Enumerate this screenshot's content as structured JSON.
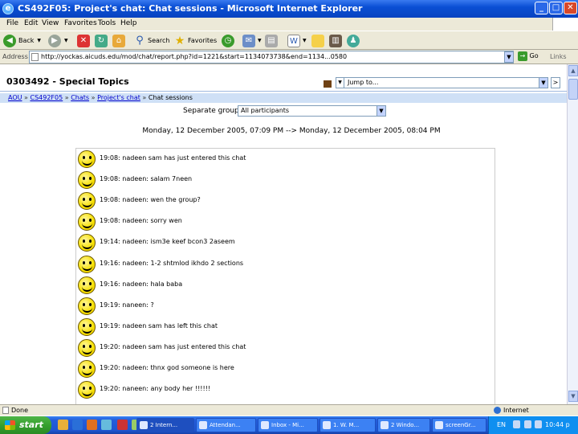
{
  "window": {
    "title": "CS492F05: Project's chat: Chat sessions - Microsoft Internet Explorer",
    "minimize": "_",
    "maximize": "□",
    "close": "✕"
  },
  "menu": [
    "File",
    "Edit",
    "View",
    "Favorites",
    "Tools",
    "Help"
  ],
  "toolbar": {
    "back": "Back",
    "search": "Search",
    "favorites": "Favorites"
  },
  "address": {
    "label": "Address",
    "url": "http://yockas.aicuds.edu/mod/chat/report.php?id=1221&start=1134073738&end=1134...0580",
    "go": "Go",
    "links": "Links"
  },
  "page": {
    "course_title": "0303492 - Special Topics",
    "jump_placeholder": "Jump to...",
    "jump_go": ">",
    "breadcrumb": {
      "site": "AOU",
      "course": "CS492F05",
      "chats": "Chats",
      "chat": "Project's chat",
      "current": "Chat sessions",
      "sep": "»"
    },
    "group_label": "Separate groups",
    "group_value": "All participants",
    "session_range": "Monday, 12 December 2005, 07:09 PM --> Monday, 12 December 2005, 08:04 PM"
  },
  "messages": [
    {
      "text": "19:08: nadeen sam has just entered this chat"
    },
    {
      "text": "19:08: nadeen: salam 7neen"
    },
    {
      "text": "19:08: nadeen: wen the group?"
    },
    {
      "text": "19:08: nadeen: sorry wen"
    },
    {
      "text": "19:14: nadeen: ism3e keef bcon3 2aseem"
    },
    {
      "text": "19:16: nadeen: 1-2 shtmlod ikhdo 2 sections"
    },
    {
      "text": "19:16: nadeen: hala baba"
    },
    {
      "text": "19:19: naneen: ?"
    },
    {
      "text": "19:19: nadeen sam has left this chat"
    },
    {
      "text": "19:20: nadeen sam has just entered this chat"
    },
    {
      "text": "19:20: nadeen: thnx god someone is here"
    },
    {
      "text": "19:20: naneen: any body her !!!!!!"
    }
  ],
  "status": {
    "left": "Done",
    "zone": "Internet"
  },
  "taskbar": {
    "start": "start",
    "tasks": [
      "2 Intern...",
      "Attendan...",
      "Inbox - Mi...",
      "1. W. M...",
      "2 Windo...",
      "screenGr..."
    ],
    "lang": "EN",
    "time": "10:44 p"
  }
}
